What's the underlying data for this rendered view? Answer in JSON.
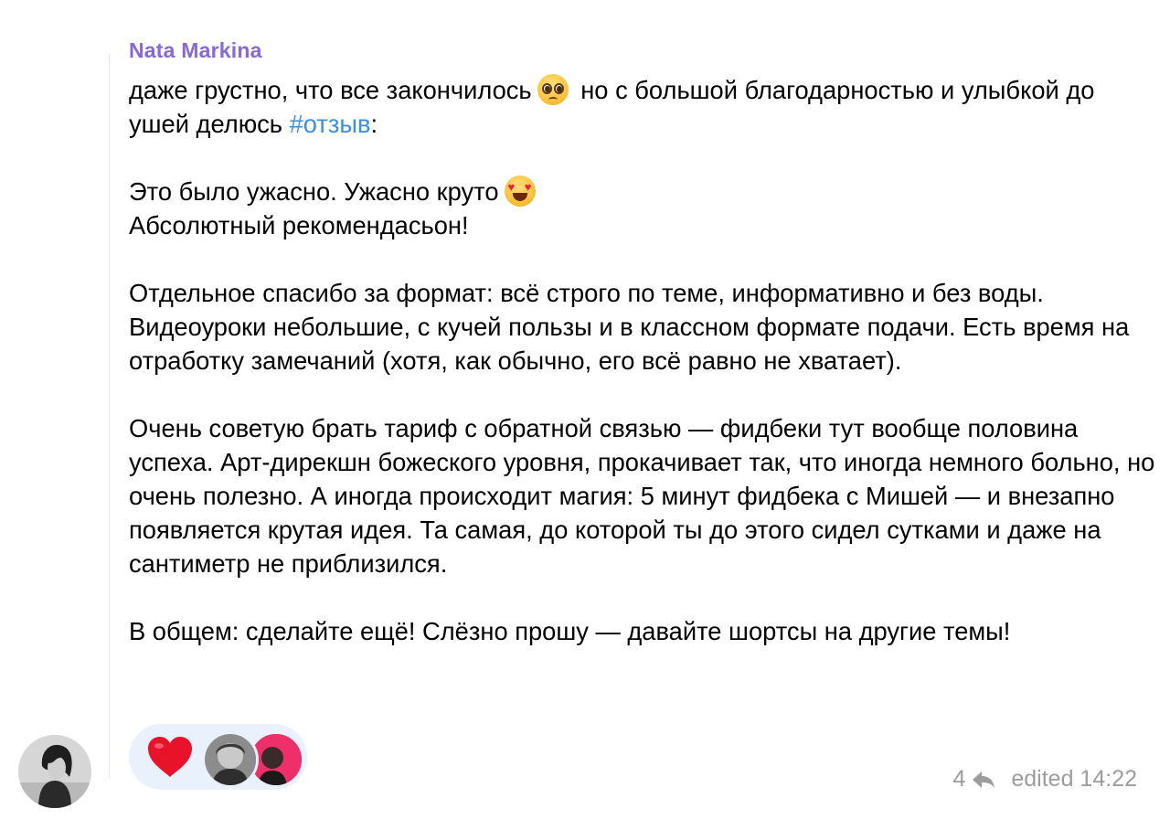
{
  "message": {
    "sender": "Nata Markina",
    "p1_a": "даже грустно, что все закончилось",
    "p1_b": " но с большой благодарностью и улыбкой до ушей делюсь ",
    "p1_hashtag": "#отзыв",
    "p1_c": ":",
    "p2_line1": "Это было ужасно. Ужасно круто",
    "p2_line2": "Абсолютный рекомендасьон!",
    "p3": "Отдельное спасибо за формат: всё строго по теме, информативно и без воды. Видеоуроки небольшие, с кучей пользы и в классном формате подачи. Есть время на отработку замечаний (хотя, как обычно, его всё равно не хватает).",
    "p4": "Очень советую брать тариф с обратной связью — фидбеки тут вообще половина успеха. Арт-дирекшн божеского уровня, прокачивает так, что иногда немного больно, но очень полезно. А иногда происходит магия: 5 минут фидбека с Мишей — и внезапно появляется крутая идея. Та самая, до которой ты до этого сидел сутками и даже на сантиметр не приблизился.",
    "p5": "В общем: сделайте ещё! Слёзно прошу — давайте шортсы на другие темы!"
  },
  "emojis": {
    "first": "pleading-face",
    "second": "smiling-face-with-heart-eyes"
  },
  "reactions": {
    "emoji": "red-heart",
    "reactor_count_shown": 2
  },
  "footer": {
    "reply_count": "4",
    "edited_time": "edited 14:22"
  },
  "colors": {
    "sender_name": "#8867d8",
    "hashtag": "#3a8fe0",
    "reaction_pill": "#e8f1fc",
    "meta_text": "#9c9c9c"
  }
}
